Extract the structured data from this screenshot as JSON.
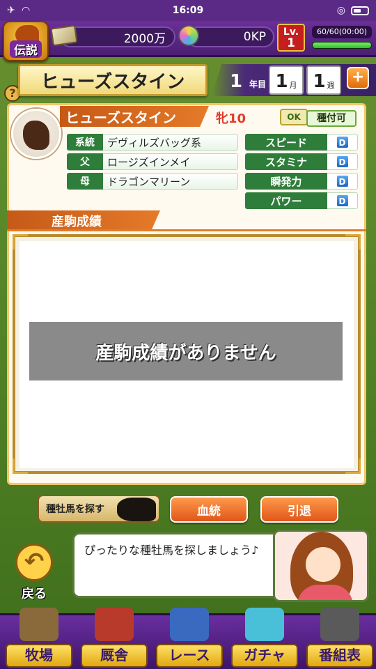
{
  "status_bar": {
    "time": "16:09"
  },
  "header": {
    "legend_label": "伝説",
    "money": "2000万",
    "kp": "0KP",
    "level_label": "Lv.",
    "level": "1",
    "stamina": "60/60(00:00)",
    "stamina_fill": 1.0
  },
  "title_banner": "ヒューズスタイン",
  "date": {
    "year": "1",
    "year_label": "年目",
    "month": "1",
    "month_label": "月",
    "week": "1",
    "week_label": "週",
    "plus": "+"
  },
  "horse": {
    "name": "ヒューズスタイン",
    "sex_age": "牝10",
    "ok_badge": "OK",
    "breed_status": "種付可",
    "info": [
      {
        "key": "系統",
        "value": "デヴィルズバッグ系"
      },
      {
        "key": "父",
        "value": "ロージズインメイ"
      },
      {
        "key": "母",
        "value": "ドラゴンマリーン"
      }
    ],
    "stats": [
      {
        "key": "スピード",
        "grade": "D"
      },
      {
        "key": "スタミナ",
        "grade": "D"
      },
      {
        "key": "瞬発力",
        "grade": "D"
      },
      {
        "key": "パワー",
        "grade": "D"
      }
    ]
  },
  "results": {
    "section_title": "産駒成績",
    "empty_message": "産駒成績がありません"
  },
  "actions": {
    "search": "種牡馬を探す",
    "pedigree": "血統",
    "retire": "引退"
  },
  "back_label": "戻る",
  "speech_text": "ぴったりな種牡馬を探しましょう♪",
  "nav": [
    {
      "label": "牧場",
      "icon": "farm-icon"
    },
    {
      "label": "厩舎",
      "icon": "stable-icon"
    },
    {
      "label": "レース",
      "icon": "race-icon"
    },
    {
      "label": "ガチャ",
      "icon": "gacha-icon"
    },
    {
      "label": "番組表",
      "icon": "schedule-icon"
    }
  ],
  "colors": {
    "purple": "#5b2a86",
    "orange": "#e57a2a",
    "green_label": "#2f7d3a",
    "grade_blue": "#1f66c0"
  }
}
